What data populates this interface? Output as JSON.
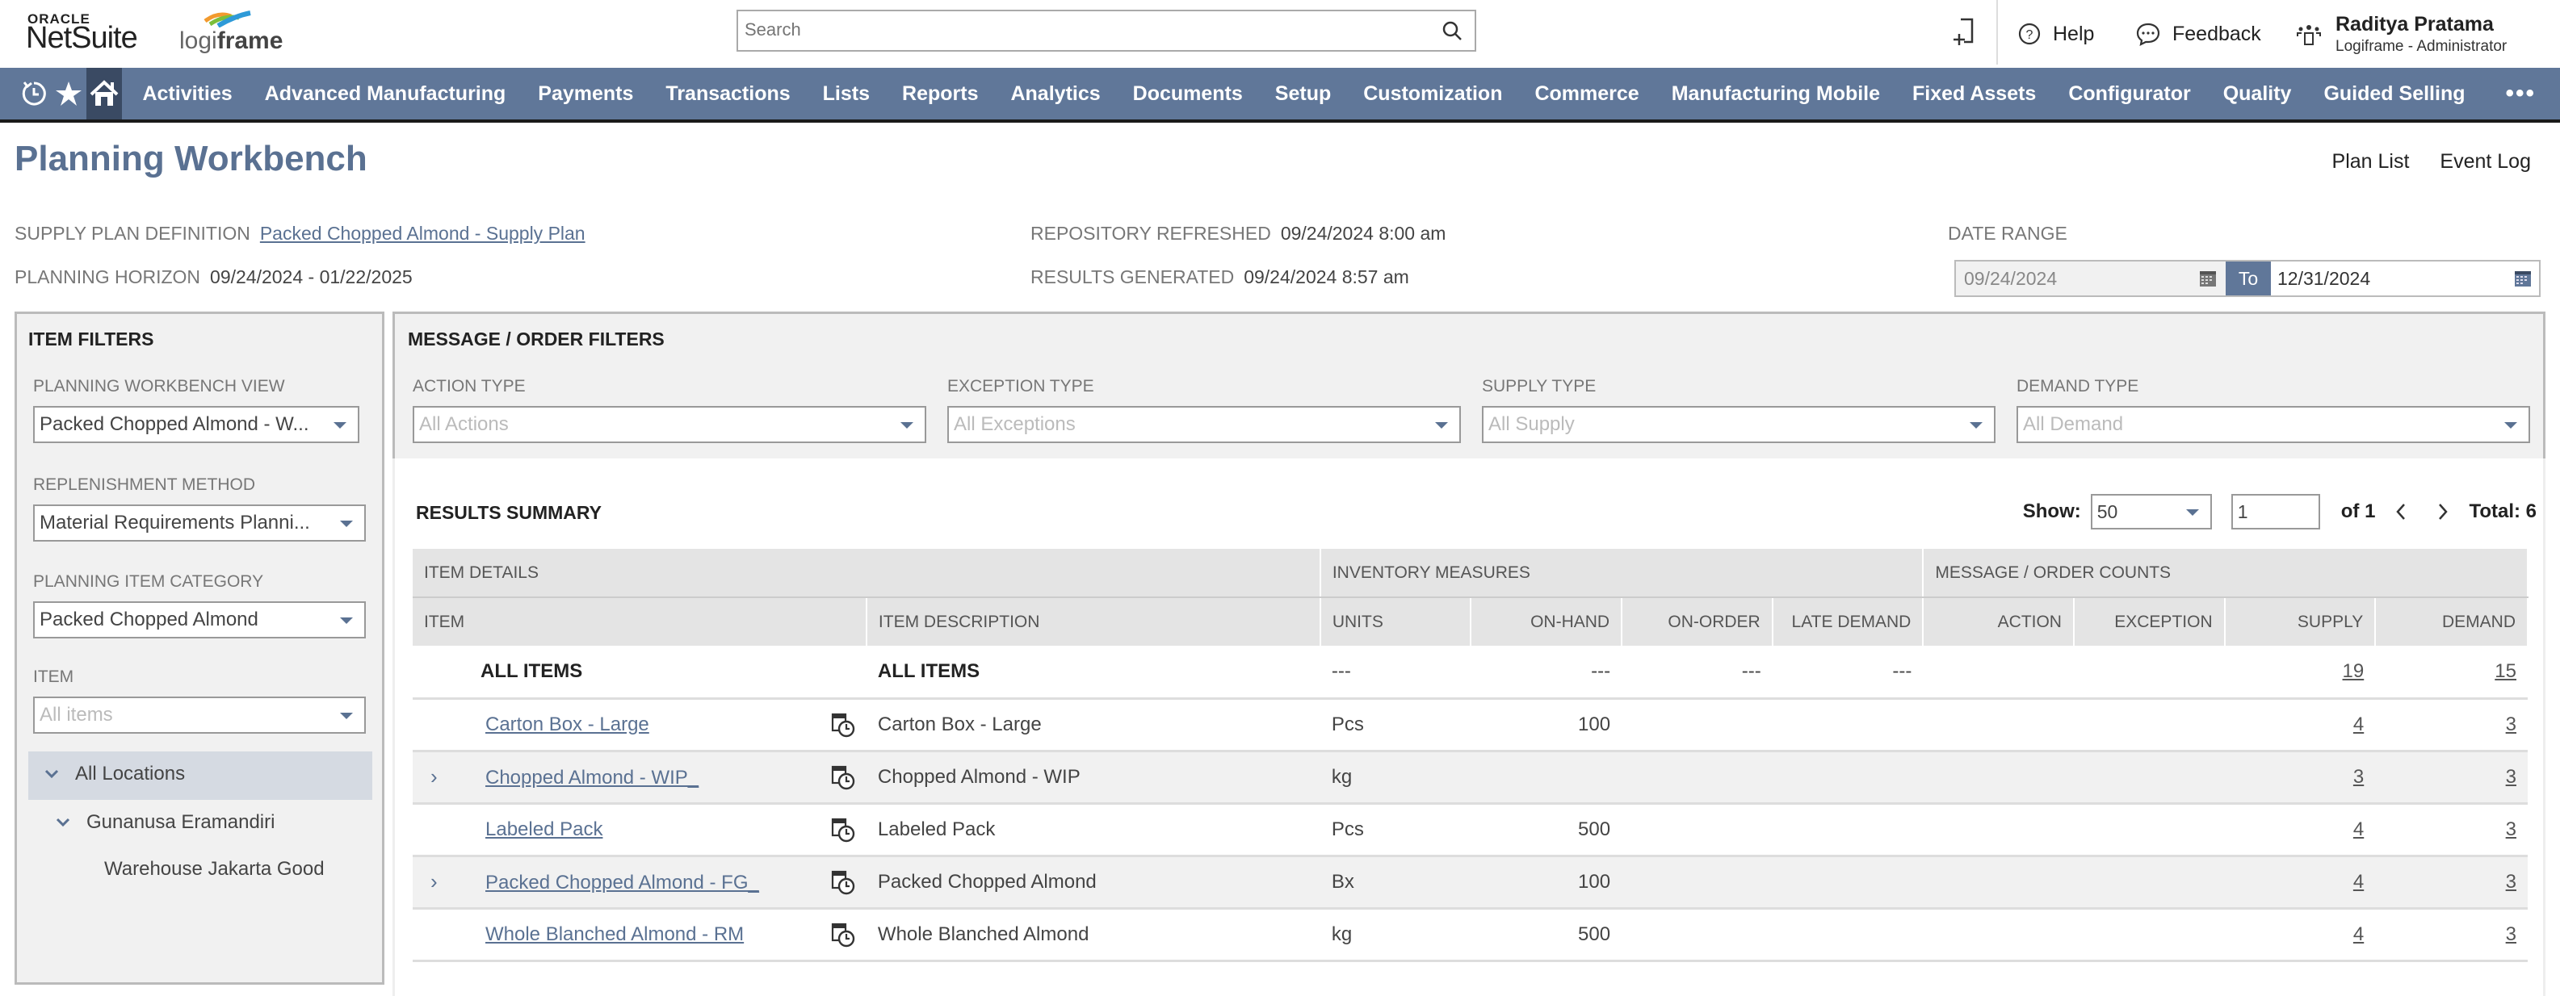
{
  "header": {
    "logo_oracle": "ORACLE",
    "logo_netsuite": "NetSuite",
    "logo_partner_light": "logi",
    "logo_partner_bold": "frame",
    "search_placeholder": "Search",
    "help_label": "Help",
    "feedback_label": "Feedback",
    "user_name": "Raditya Pratama",
    "user_role": "Logiframe - Administrator"
  },
  "nav": {
    "items": [
      "Activities",
      "Advanced Manufacturing",
      "Payments",
      "Transactions",
      "Lists",
      "Reports",
      "Analytics",
      "Documents",
      "Setup",
      "Customization",
      "Commerce",
      "Manufacturing Mobile",
      "Fixed Assets",
      "Configurator",
      "Quality",
      "Guided Selling"
    ],
    "more": "•••"
  },
  "page": {
    "title": "Planning Workbench",
    "links": {
      "plan_list": "Plan List",
      "event_log": "Event Log"
    },
    "supply_plan_label": "SUPPLY PLAN DEFINITION",
    "supply_plan_value": "Packed Chopped Almond - Supply Plan",
    "horizon_label": "PLANNING HORIZON",
    "horizon_value": "09/24/2024 - 01/22/2025",
    "repo_label": "REPOSITORY REFRESHED",
    "repo_value": "09/24/2024 8:00 am",
    "results_label": "RESULTS GENERATED",
    "results_value": "09/24/2024 8:57 am",
    "date_range_label": "DATE RANGE",
    "date_from": "09/24/2024",
    "date_to_label": "To",
    "date_to": "12/31/2024"
  },
  "item_filters": {
    "title": "ITEM FILTERS",
    "view_label": "PLANNING WORKBENCH VIEW",
    "view_value": "Packed Chopped Almond - W...",
    "replenishment_label": "REPLENISHMENT METHOD",
    "replenishment_value": "Material Requirements Planni...",
    "category_label": "PLANNING ITEM CATEGORY",
    "category_value": "Packed Chopped Almond",
    "item_label": "ITEM",
    "item_placeholder": "All items",
    "locations": {
      "root": "All Locations",
      "child": "Gunanusa Eramandiri",
      "leaf": "Warehouse Jakarta Good"
    }
  },
  "message_filters": {
    "title": "MESSAGE / ORDER FILTERS",
    "fields": [
      {
        "label": "ACTION TYPE",
        "placeholder": "All Actions"
      },
      {
        "label": "EXCEPTION TYPE",
        "placeholder": "All Exceptions"
      },
      {
        "label": "SUPPLY TYPE",
        "placeholder": "All Supply"
      },
      {
        "label": "DEMAND TYPE",
        "placeholder": "All Demand"
      }
    ]
  },
  "results": {
    "title": "RESULTS SUMMARY",
    "show_label": "Show:",
    "show_value": "50",
    "page_value": "1",
    "of_pages": "of 1",
    "total": "Total: 6",
    "groups": [
      "ITEM DETAILS",
      "INVENTORY MEASURES",
      "MESSAGE / ORDER COUNTS"
    ],
    "columns": [
      "ITEM",
      "ITEM DESCRIPTION",
      "UNITS",
      "ON-HAND",
      "ON-ORDER",
      "LATE DEMAND",
      "ACTION",
      "EXCEPTION",
      "SUPPLY",
      "DEMAND"
    ],
    "summary_row": {
      "item": "ALL ITEMS",
      "description": "ALL ITEMS",
      "units": "---",
      "on_hand": "---",
      "on_order": "---",
      "late_demand": "---",
      "action": "",
      "exception": "",
      "supply": "19",
      "demand": "15"
    },
    "rows": [
      {
        "item": "Carton Box - Large",
        "expandable": false,
        "description": "Carton Box - Large",
        "units": "Pcs",
        "on_hand": "100",
        "on_order": "",
        "late_demand": "",
        "action": "",
        "exception": "",
        "supply": "4",
        "demand": "3"
      },
      {
        "item": "Chopped Almond - WIP_",
        "expandable": true,
        "description": "Chopped Almond - WIP",
        "units": "kg",
        "on_hand": "",
        "on_order": "",
        "late_demand": "",
        "action": "",
        "exception": "",
        "supply": "3",
        "demand": "3"
      },
      {
        "item": "Labeled Pack",
        "expandable": false,
        "description": "Labeled Pack",
        "units": "Pcs",
        "on_hand": "500",
        "on_order": "",
        "late_demand": "",
        "action": "",
        "exception": "",
        "supply": "4",
        "demand": "3"
      },
      {
        "item": "Packed Chopped Almond - FG_",
        "expandable": true,
        "description": "Packed Chopped Almond",
        "units": "Bx",
        "on_hand": "100",
        "on_order": "",
        "late_demand": "",
        "action": "",
        "exception": "",
        "supply": "4",
        "demand": "3"
      },
      {
        "item": "Whole Blanched Almond - RM",
        "expandable": false,
        "description": "Whole Blanched Almond",
        "units": "kg",
        "on_hand": "500",
        "on_order": "",
        "late_demand": "",
        "action": "",
        "exception": "",
        "supply": "4",
        "demand": "3"
      }
    ]
  },
  "colors": {
    "brand_nav": "#607799",
    "nav_active": "#3a4a63",
    "title_accent": "#5a7192",
    "panel_bg": "#f1f1f1"
  }
}
